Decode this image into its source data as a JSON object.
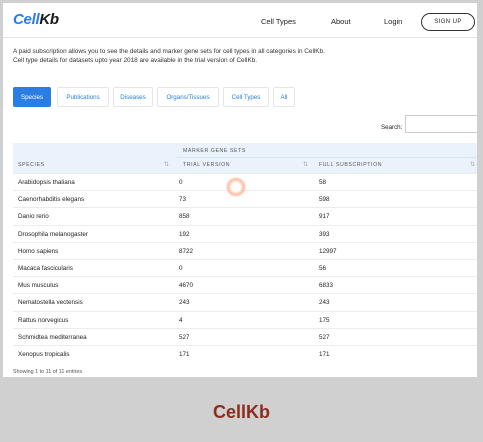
{
  "header": {
    "logo_prefix": "Cell",
    "logo_suffix": "Kb",
    "nav": [
      "Cell Types",
      "About",
      "Login"
    ],
    "signup_label": "SIGN UP"
  },
  "notice": {
    "line1": "A paid subscription allows you to see the details and marker gene sets for cell types in all categories in CellKb.",
    "line2": "Cell type details for datasets upto year 2018 are available in the trial version of CellKb."
  },
  "tabs": [
    {
      "label": "Species",
      "active": true
    },
    {
      "label": "Publications",
      "active": false
    },
    {
      "label": "Diseases",
      "active": false
    },
    {
      "label": "Organs/Tissues",
      "active": false
    },
    {
      "label": "Cell Types",
      "active": false
    },
    {
      "label": "All",
      "active": false
    }
  ],
  "search": {
    "label": "Search:",
    "value": ""
  },
  "table": {
    "group_header": "MARKER GENE SETS",
    "columns": [
      "SPECIES",
      "TRIAL VERSION",
      "FULL SUBSCRIPTION"
    ],
    "rows": [
      [
        "Arabidopsis thaliana",
        "0",
        "58"
      ],
      [
        "Caenorhabditis elegans",
        "73",
        "598"
      ],
      [
        "Danio rerio",
        "858",
        "917"
      ],
      [
        "Drosophila melanogaster",
        "192",
        "393"
      ],
      [
        "Homo sapiens",
        "8722",
        "12997"
      ],
      [
        "Macaca fascicularis",
        "0",
        "56"
      ],
      [
        "Mus musculus",
        "4670",
        "6833"
      ],
      [
        "Nematostella vectensis",
        "243",
        "243"
      ],
      [
        "Rattus norvegicus",
        "4",
        "175"
      ],
      [
        "Schmidtea mediterranea",
        "527",
        "527"
      ],
      [
        "Xenopus tropicalis",
        "171",
        "171"
      ]
    ],
    "info": "Showing 1 to 11 of 11 entries"
  },
  "caption": "CellKb",
  "colors": {
    "accent": "#2a7de1",
    "caption": "#8b2c1e",
    "header_bg": "#eaf3fb"
  }
}
